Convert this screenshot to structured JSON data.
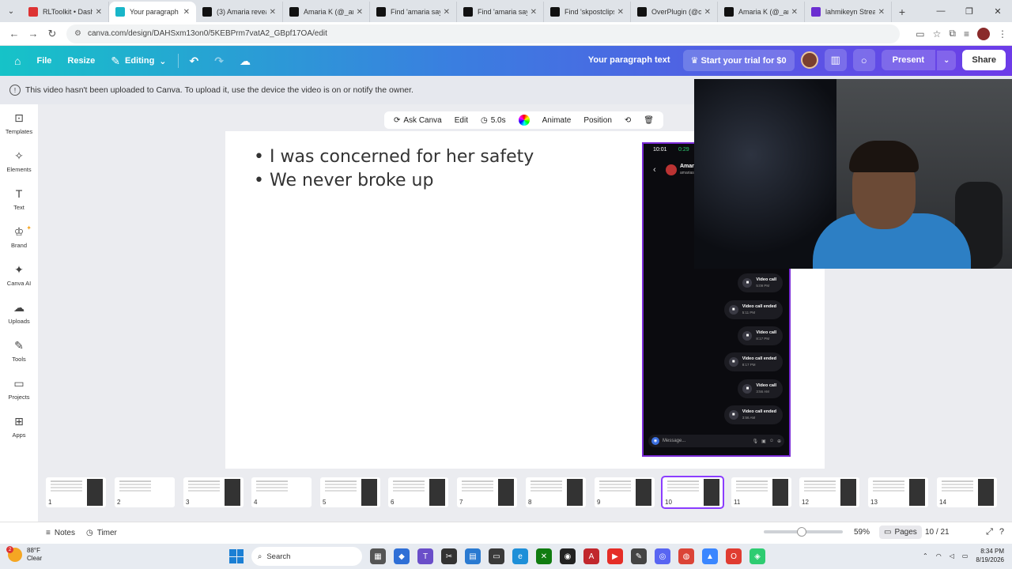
{
  "browser": {
    "tabs": [
      {
        "label": "RLToolkit • Dashb",
        "color": "#d33"
      },
      {
        "label": "Your paragraph te",
        "color": "#19b6c9",
        "active": true
      },
      {
        "label": "(3) Amaria reveal",
        "color": "#111"
      },
      {
        "label": "Amaria K (@_ama",
        "color": "#111"
      },
      {
        "label": "Find 'amaria says",
        "color": "#111"
      },
      {
        "label": "Find 'amaria says",
        "color": "#111"
      },
      {
        "label": "Find 'skpostclips",
        "color": "#111"
      },
      {
        "label": "OverPlugin (@ove",
        "color": "#111"
      },
      {
        "label": "Amaria K (@_ama",
        "color": "#111"
      },
      {
        "label": "lahmikeyn Stream",
        "color": "#6b2ed1"
      }
    ],
    "url": "canva.com/design/DAHSxm13on0/5KEBPrm7vatA2_GBpf17OA/edit"
  },
  "header": {
    "file": "File",
    "resize": "Resize",
    "editing": "Editing",
    "doc_title": "Your paragraph text",
    "trial": "Start your trial for $0",
    "present": "Present",
    "share": "Share"
  },
  "notice": "This video hasn't been uploaded to Canva. To upload it, use the device the video is on or notify the owner.",
  "sidebar": [
    {
      "label": "Templates",
      "icon": "⊡"
    },
    {
      "label": "Elements",
      "icon": "✧"
    },
    {
      "label": "Text",
      "icon": "T"
    },
    {
      "label": "Brand",
      "icon": "♔"
    },
    {
      "label": "Canva AI",
      "icon": "✦"
    },
    {
      "label": "Uploads",
      "icon": "☁"
    },
    {
      "label": "Tools",
      "icon": "✎"
    },
    {
      "label": "Projects",
      "icon": "▭"
    },
    {
      "label": "Apps",
      "icon": "⊞"
    }
  ],
  "toolbar": {
    "ask_canva": "Ask Canva",
    "edit": "Edit",
    "duration": "5.0s",
    "animate": "Animate",
    "position": "Position"
  },
  "slide": {
    "bullets": [
      "I was concerned for her safety",
      "We never broke up"
    ]
  },
  "phone": {
    "time": "10:01",
    "call_time": "0:29",
    "contact": "Amari",
    "contact_sub": "amarias",
    "calls": [
      {
        "text": "Video call",
        "time": "5:09 PM"
      },
      {
        "text": "Video call ended",
        "time": "5:11 PM"
      },
      {
        "text": "Video call",
        "time": "8:17 PM"
      },
      {
        "text": "Video call ended",
        "time": "8:17 PM"
      },
      {
        "text": "Video call",
        "time": "3:56 AM"
      },
      {
        "text": "Video call ended",
        "time": "3:56 AM"
      }
    ],
    "message_placeholder": "Message..."
  },
  "pages": {
    "thumbs": [
      "1",
      "2",
      "3",
      "4",
      "5",
      "6",
      "7",
      "8",
      "9",
      "10",
      "11",
      "12",
      "13",
      "14"
    ],
    "active": "10"
  },
  "footer": {
    "notes": "Notes",
    "timer": "Timer",
    "zoom": "59%",
    "pages_label": "Pages",
    "page_count": "10 / 21"
  },
  "taskbar": {
    "temp": "88°F",
    "weather": "Clear",
    "badge": "2",
    "search": "Search",
    "time": "8:34 PM",
    "date": "8/19/2026"
  }
}
